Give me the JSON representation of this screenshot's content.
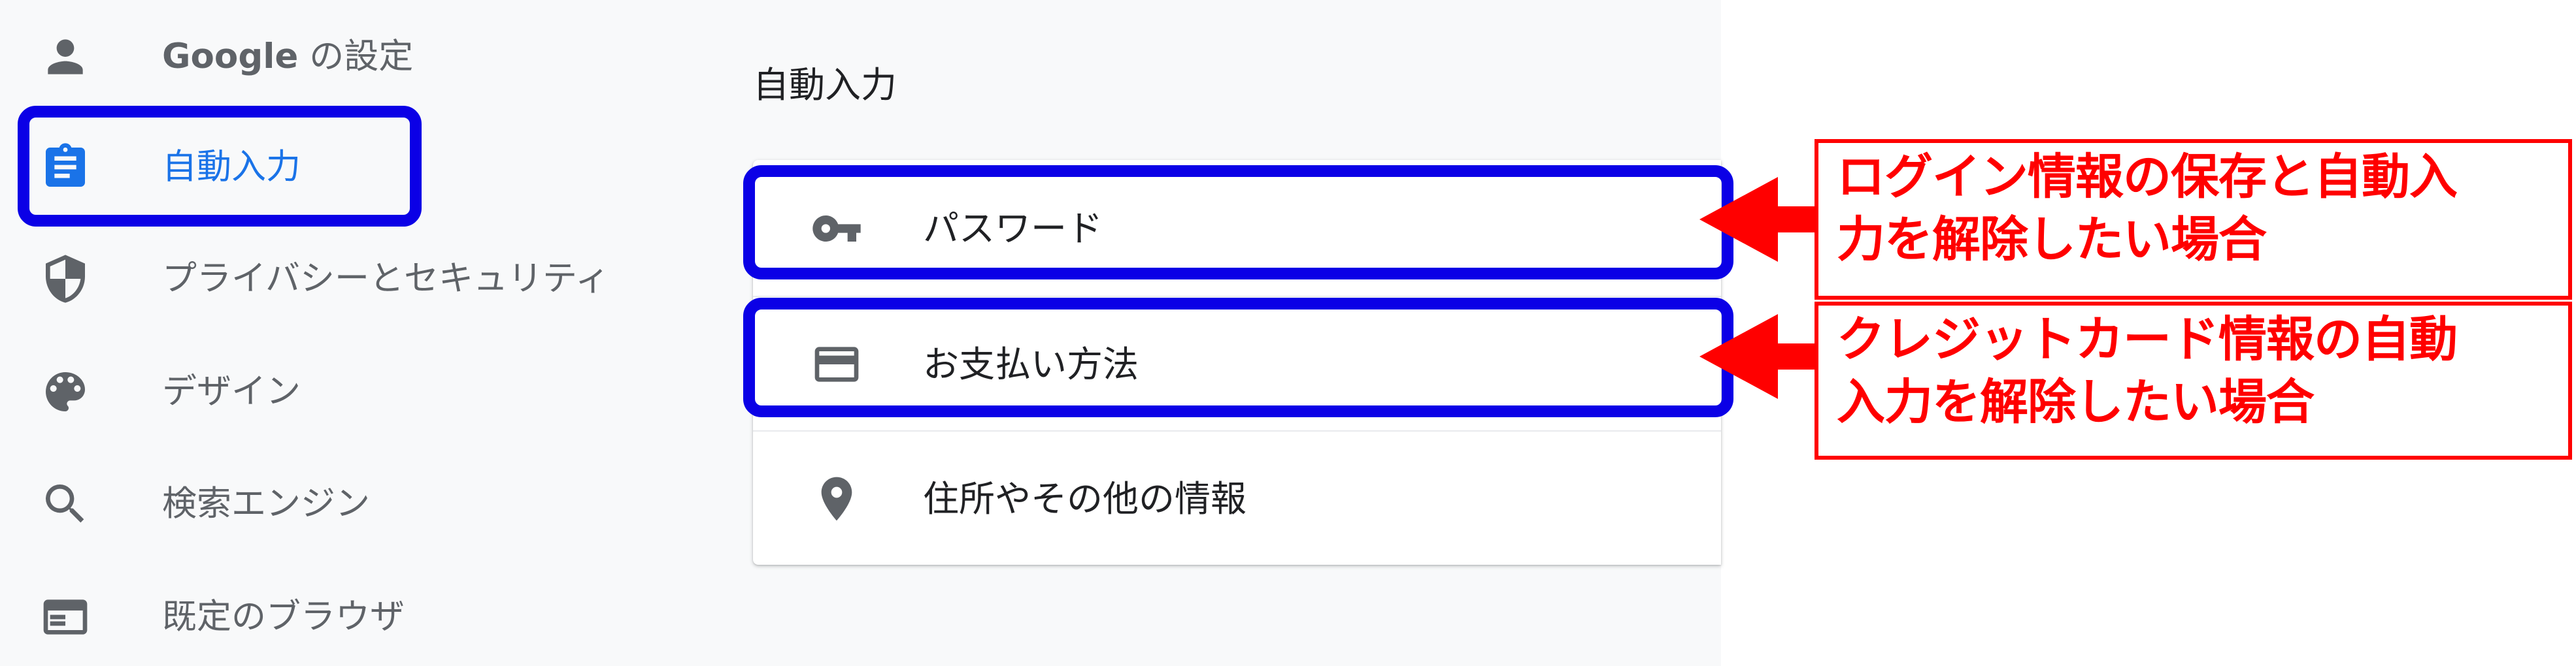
{
  "sidebar": {
    "items": [
      {
        "brand": "Google",
        "label": " の設定",
        "icon": "person-icon"
      },
      {
        "label": "自動入力",
        "icon": "assignment-icon",
        "active": true
      },
      {
        "label": "プライバシーとセキュリティ",
        "icon": "shield-icon"
      },
      {
        "label": "デザイン",
        "icon": "palette-icon"
      },
      {
        "label": "検索エンジン",
        "icon": "search-icon"
      },
      {
        "label": "既定のブラウザ",
        "icon": "browser-icon"
      }
    ]
  },
  "main": {
    "section_title": "自動入力",
    "rows": [
      {
        "label": "パスワード",
        "icon": "key-icon"
      },
      {
        "label": "お支払い方法",
        "icon": "credit-card-icon"
      },
      {
        "label": "住所やその他の情報",
        "icon": "location-pin-icon"
      }
    ]
  },
  "annotations": {
    "passwords_note_line1": "ログイン情報の保存と自動入",
    "passwords_note_line2": "力を解除したい場合",
    "payments_note_line1": "クレジットカード情報の自動",
    "payments_note_line2": "入力を解除したい場合"
  },
  "colors": {
    "accent": "#1a73e8",
    "highlight_border": "#0b00e6",
    "callout": "#ff0000",
    "text_primary": "#202124",
    "text_secondary": "#5f6368"
  }
}
